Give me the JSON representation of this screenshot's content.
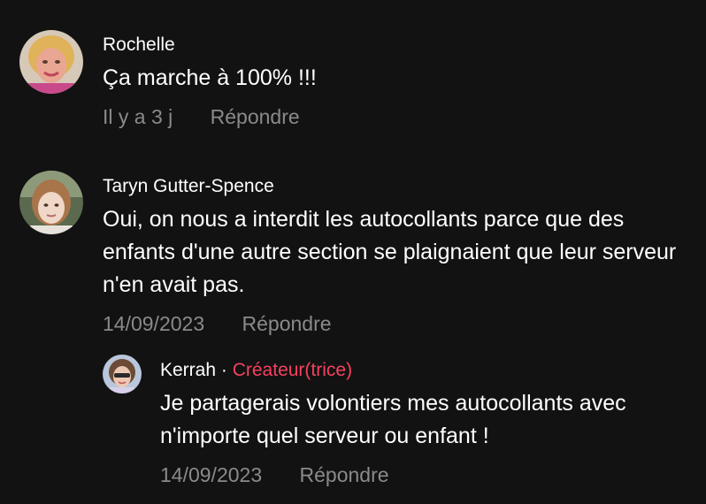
{
  "comments": [
    {
      "author": "Rochelle",
      "text": "Ça marche à 100% !!!",
      "time": "Il y a 3 j",
      "reply_label": "Répondre"
    },
    {
      "author": "Taryn Gutter-Spence",
      "text": "Oui, on nous a interdit les autocollants parce que des enfants d'une autre section se plaignaient que leur serveur n'en avait pas.",
      "time": "14/09/2023",
      "reply_label": "Répondre"
    }
  ],
  "reply": {
    "author": "Kerrah",
    "separator": "·",
    "creator_tag": "Créateur(trice)",
    "text": "Je partagerais volontiers mes autocollants avec n'importe quel serveur ou enfant !",
    "time": "14/09/2023",
    "reply_label": "Répondre"
  },
  "colors": {
    "background": "#121212",
    "secondary_text": "#8a8a8a",
    "creator_accent": "#f5415f"
  }
}
